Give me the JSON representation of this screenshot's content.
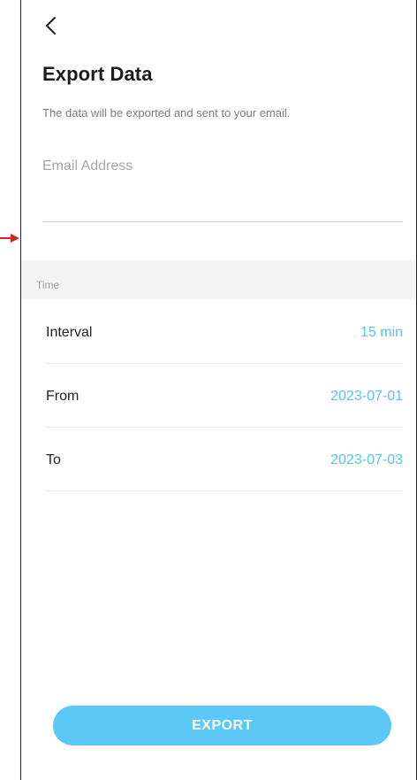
{
  "header": {
    "back_icon": "chevron-left-icon",
    "title": "Export Data",
    "subtitle": "The data will be exported and sent to your email."
  },
  "email": {
    "value": "",
    "placeholder": "Email Address"
  },
  "time_section": {
    "label": "Time",
    "rows": [
      {
        "label": "Interval",
        "value": "15 min"
      },
      {
        "label": "From",
        "value": "2023-07-01"
      },
      {
        "label": "To",
        "value": "2023-07-03"
      }
    ]
  },
  "export_button": {
    "label": "EXPORT"
  },
  "colors": {
    "accent": "#5bc1f2",
    "button": "#5cc8f8",
    "section_bg": "#f3f3f3",
    "annotation_arrow": "#d2202c"
  }
}
